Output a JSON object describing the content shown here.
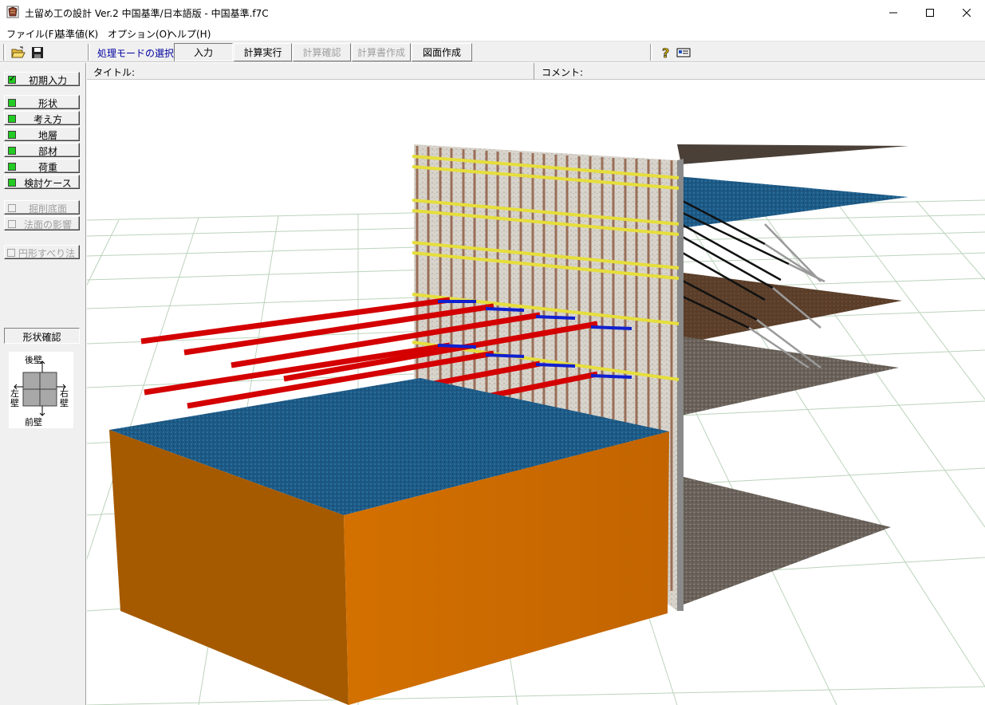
{
  "window": {
    "title": "土留め工の設計 Ver.2 中国基準/日本語版 - 中国基準.f7C",
    "minimize_glyph": "—",
    "maximize_glyph": "☐",
    "close_glyph": "✕"
  },
  "menu": {
    "items": [
      {
        "label": "ファイル(F)"
      },
      {
        "label": "基準値(K)"
      },
      {
        "label": "オプション(O)"
      },
      {
        "label": "ヘルプ(H)"
      }
    ]
  },
  "toolbar": {
    "mode_label": "処理モードの選択",
    "buttons": [
      {
        "label": "入力",
        "state": "pressed"
      },
      {
        "label": "計算実行",
        "state": "normal"
      },
      {
        "label": "計算確認",
        "state": "disabled"
      },
      {
        "label": "計算書作成",
        "state": "disabled"
      },
      {
        "label": "図面作成",
        "state": "normal"
      }
    ],
    "icons": [
      "open-folder-icon",
      "save-disk-icon",
      "help-question-icon",
      "info-card-icon"
    ]
  },
  "infobar": {
    "title_label": "タイトル:",
    "comment_label": "コメント:"
  },
  "left_panel": {
    "initial_input": "初期入力",
    "items": [
      {
        "label": "形状",
        "enabled": true
      },
      {
        "label": "考え方",
        "enabled": true
      },
      {
        "label": "地層",
        "enabled": true
      },
      {
        "label": "部材",
        "enabled": true
      },
      {
        "label": "荷重",
        "enabled": true
      },
      {
        "label": "検討ケース",
        "enabled": true
      }
    ],
    "extra_items": [
      {
        "label": "掘削底面",
        "enabled": false
      },
      {
        "label": "法面の影響",
        "enabled": false
      }
    ],
    "circular_slip": "円形すべり法",
    "shape_confirm": "形状確認",
    "wall_labels": {
      "back": "後壁",
      "left": "左壁",
      "right": "右壁",
      "front": "前壁"
    }
  },
  "colors": {
    "accent_blue": "#0000a0",
    "indicator_green": "#22cc22",
    "soil_orange": "#c96a00",
    "anchor_red": "#e00000",
    "wale_yellow": "#e8e040",
    "water_blue": "#1f5f8a"
  }
}
